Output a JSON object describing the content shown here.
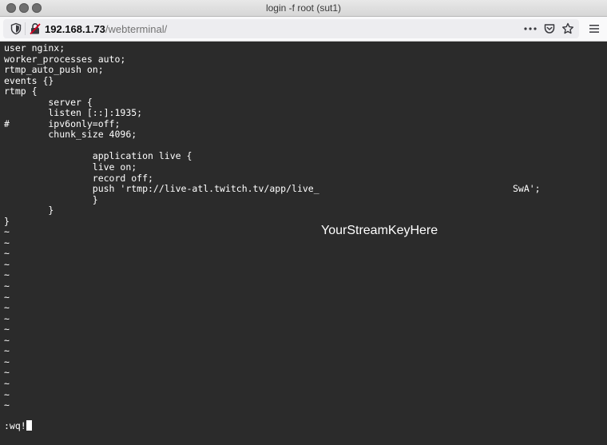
{
  "window": {
    "title": "login -f root (sut1)"
  },
  "toolbar": {
    "url_host": "192.168.1.73",
    "url_path": "/webterminal/",
    "icons": [
      "shield-icon",
      "insecure-lock-icon",
      "more-icon",
      "pocket-icon",
      "star-icon",
      "menu-icon"
    ]
  },
  "terminal": {
    "lines": [
      "user nginx;",
      "worker_processes auto;",
      "rtmp_auto_push on;",
      "events {}",
      "rtmp {",
      "        server {",
      "        listen [::]:1935;",
      "#       ipv6only=off;",
      "        chunk_size 4096;",
      "",
      "                application live {",
      "                live on;",
      "                record off;",
      "                push 'rtmp://live-atl.twitch.tv/app/live_                                   SwA';",
      "                }",
      "        }",
      "}",
      "~",
      "~",
      "~",
      "~",
      "~",
      "~",
      "~",
      "~",
      "~",
      "~",
      "~",
      "~",
      "~",
      "~",
      "~",
      "~",
      "~"
    ],
    "overlay_label": "YourStreamKeyHere",
    "command": ":wq!",
    "colors": {
      "background": "#2b2b2b",
      "foreground": "#ffffff"
    }
  }
}
